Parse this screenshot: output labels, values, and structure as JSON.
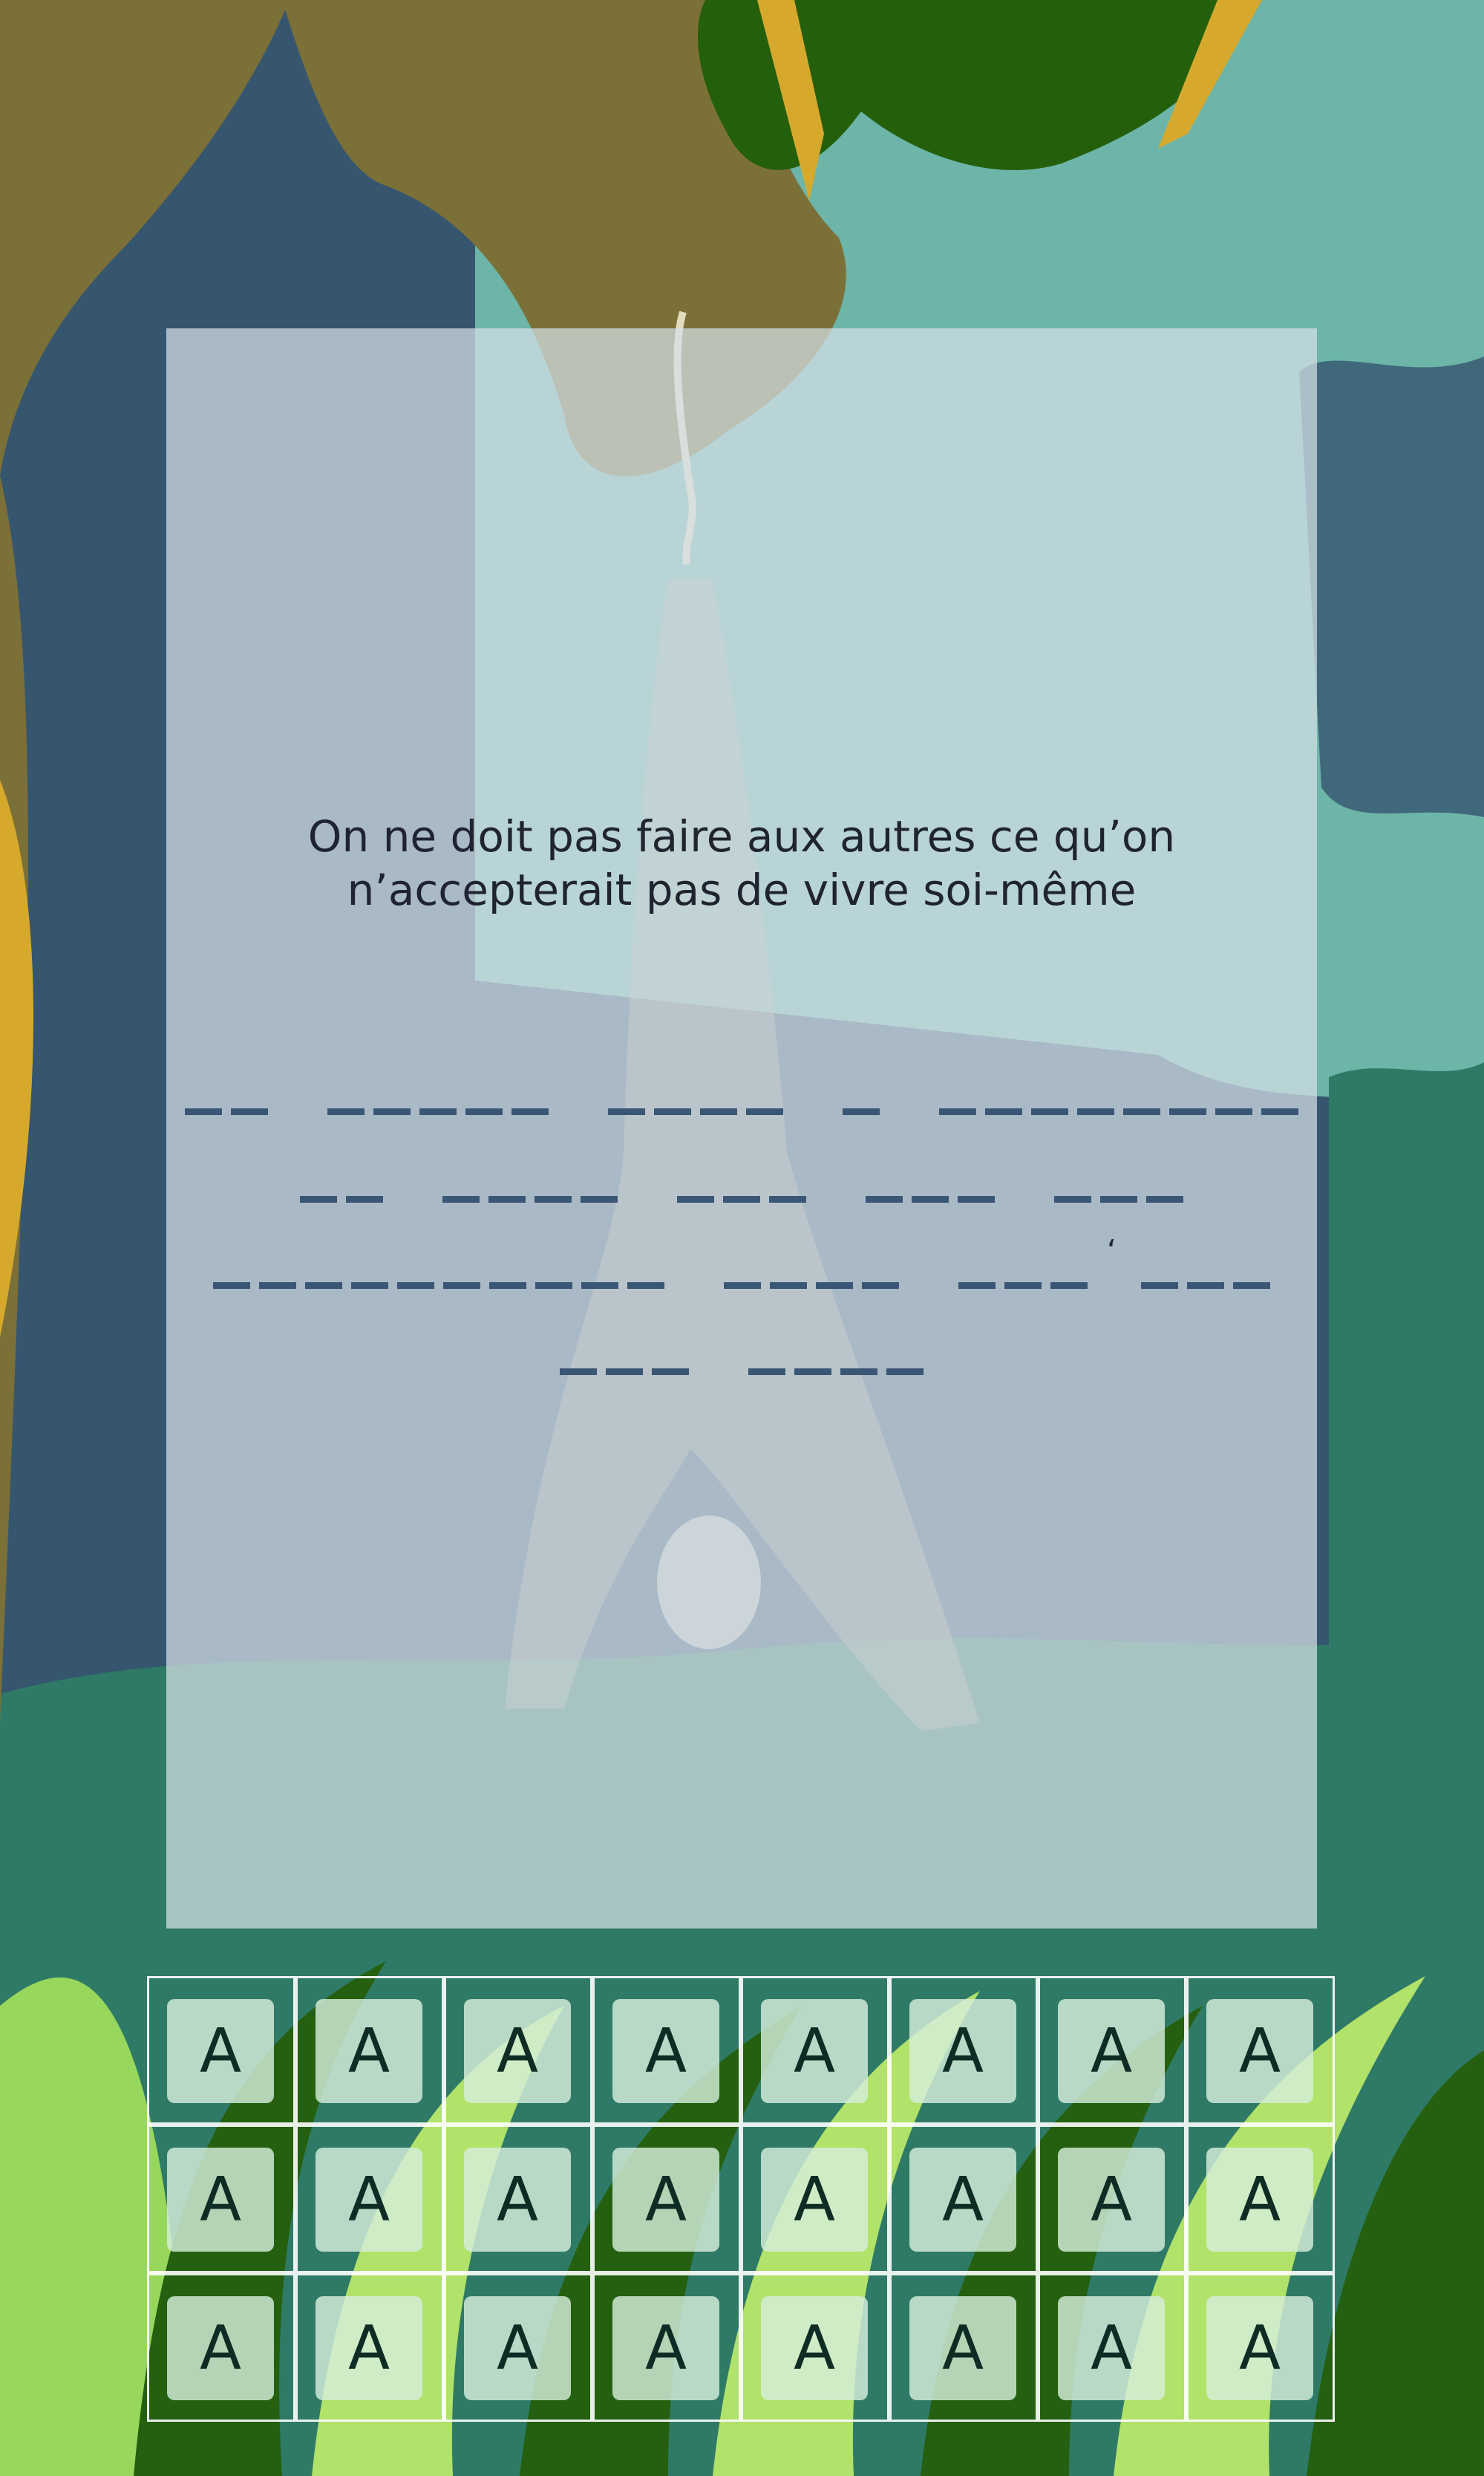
{
  "colors": {
    "sky": "#36556f",
    "forest_light": "#6cb5a8",
    "forest_dark": "#2f7a66",
    "branch": "#7b7037",
    "leaf": "#245f0c",
    "grass_light": "#b9e86a",
    "blank": "#3a5675",
    "tile_text": "#0f2c24"
  },
  "clue": {
    "line1": "On ne doit pas faire aux autres ce qu’on",
    "line2": "n’accepterait pas de vivre soi-même"
  },
  "puzzle": {
    "rows": [
      {
        "words": [
          2,
          5,
          4,
          1,
          8
        ]
      },
      {
        "words": [
          2,
          4,
          3,
          3,
          3
        ]
      },
      {
        "words": [
          10,
          4,
          3,
          3
        ],
        "apostrophe_after_word": 2
      },
      {
        "words": [
          3,
          4
        ]
      }
    ],
    "apostrophe": "‘"
  },
  "letters": {
    "rows": [
      [
        "A",
        "A",
        "A",
        "A",
        "A",
        "A",
        "A",
        "A"
      ],
      [
        "A",
        "A",
        "A",
        "A",
        "A",
        "A",
        "A",
        "A"
      ],
      [
        "A",
        "A",
        "A",
        "A",
        "A",
        "A",
        "A",
        "A"
      ]
    ]
  }
}
